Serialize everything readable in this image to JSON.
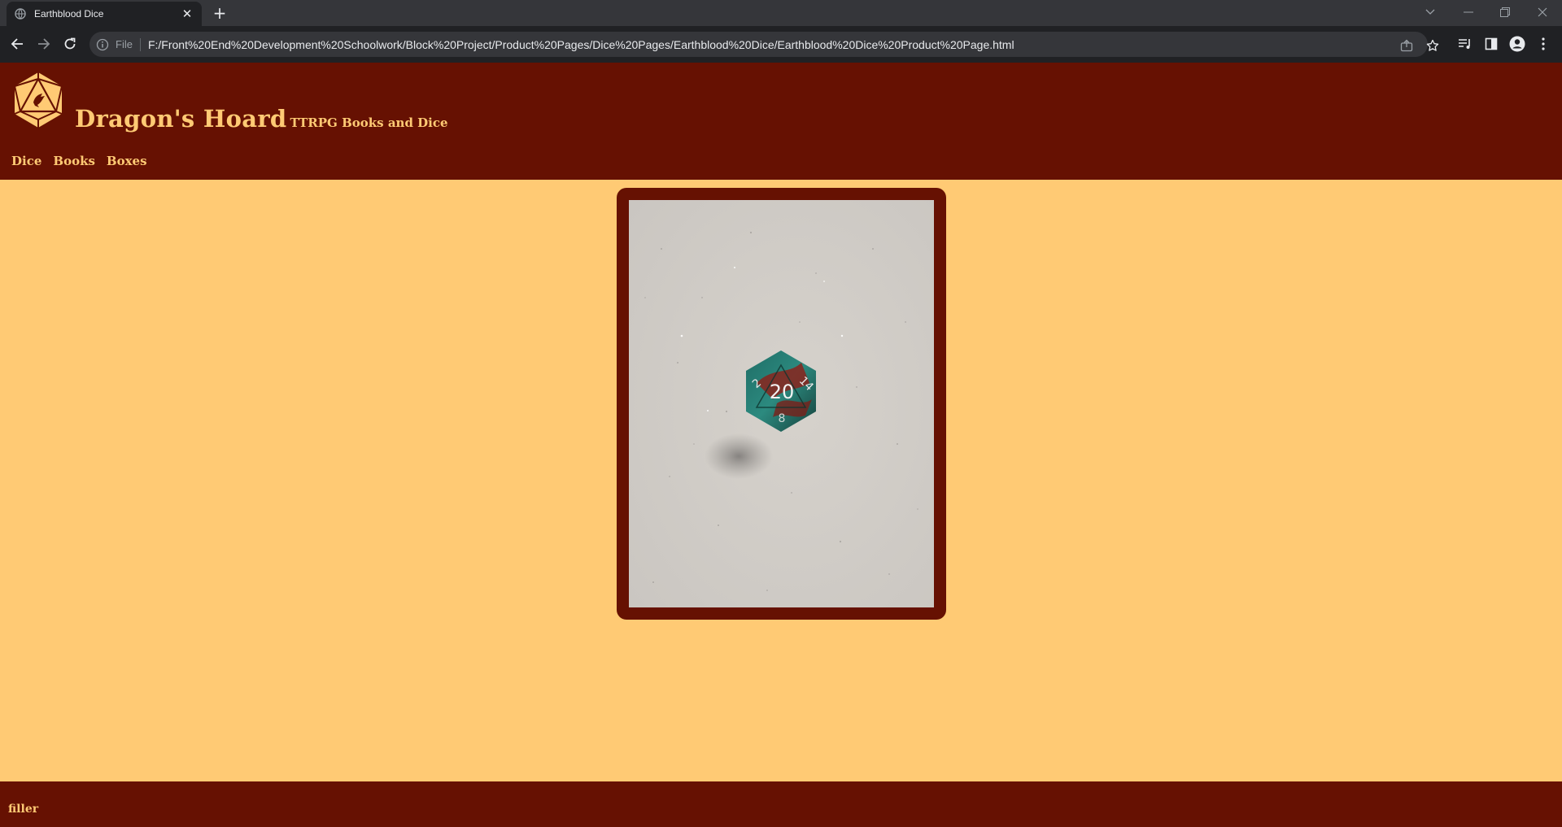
{
  "browser": {
    "tab_title": "Earthblood Dice",
    "new_tab_icon": "plus-icon",
    "scheme_label": "File",
    "url": "F:/Front%20End%20Development%20Schoolwork/Block%20Project/Product%20Pages/Dice%20Pages/Earthblood%20Dice/Earthblood%20Dice%20Product%20Page.html"
  },
  "header": {
    "site_name": "Dragon's Hoard",
    "tagline": "TTRPG Books and Dice",
    "logo_icon": "d20-dragon-logo"
  },
  "nav": {
    "items": [
      "Dice",
      "Books",
      "Boxes"
    ]
  },
  "product": {
    "image_alt": "Earthblood Dice",
    "die_face": "20",
    "die_number_left": "2",
    "die_number_right": "14",
    "die_number_bottom": "8"
  },
  "footer": {
    "text": "filler"
  },
  "colors": {
    "brand_dark": "#661102",
    "brand_light": "#ffca74",
    "chrome_dark": "#202124",
    "chrome_tabbar": "#35363a"
  }
}
